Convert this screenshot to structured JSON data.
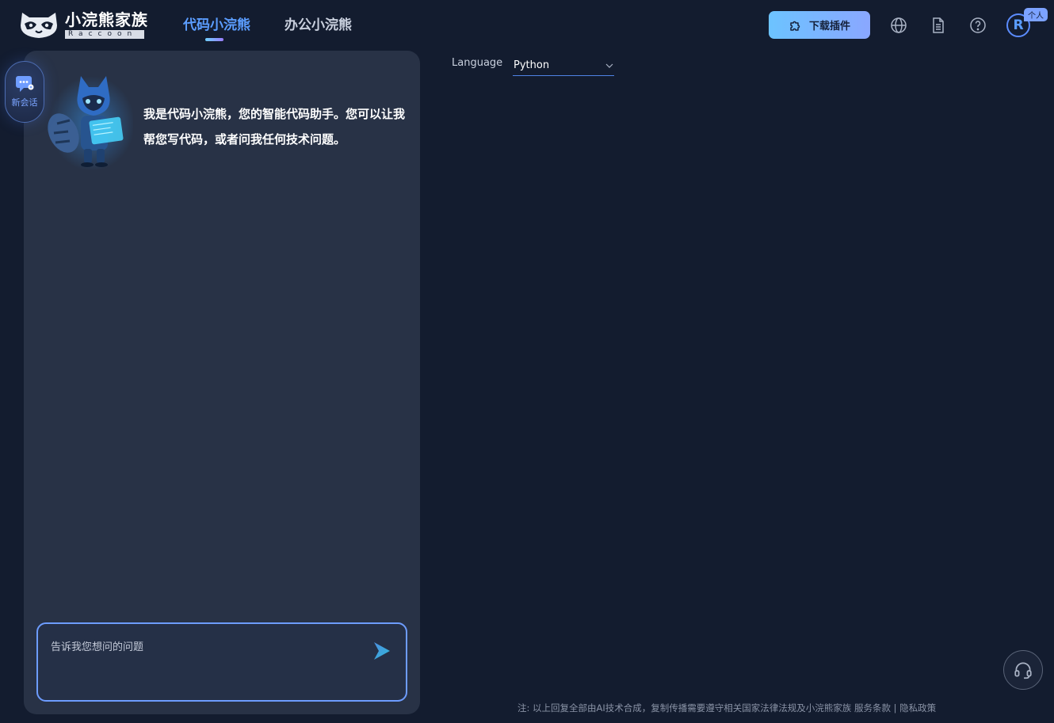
{
  "header": {
    "logo_title": "小浣熊家族",
    "logo_sub": "Raccoon",
    "tabs": [
      {
        "label": "代码小浣熊",
        "active": true
      },
      {
        "label": "办公小浣熊",
        "active": false
      }
    ],
    "download_label": "下载插件",
    "avatar_initial": "R",
    "avatar_badge": "个人",
    "icons": [
      "globe-icon",
      "document-icon",
      "help-icon"
    ]
  },
  "sidebar": {
    "new_chat_label": "新会话"
  },
  "chat": {
    "welcome": "我是代码小浣熊，您的智能代码助手。您可以让我帮您写代码，或者问我任何技术问题。",
    "input_placeholder": "告诉我您想问的问题"
  },
  "code": {
    "language_label": "Language",
    "language_value": "Python"
  },
  "footer": {
    "note": "注: 以上回复全部由AI技术合成，复制传播需要遵守相关国家法律法规及小浣熊家族",
    "terms": "服务条款",
    "separator": "|",
    "privacy": "隐私政策"
  },
  "colors": {
    "background": "#131c2f",
    "panel": "#283246",
    "accent": "#5b9dff"
  }
}
